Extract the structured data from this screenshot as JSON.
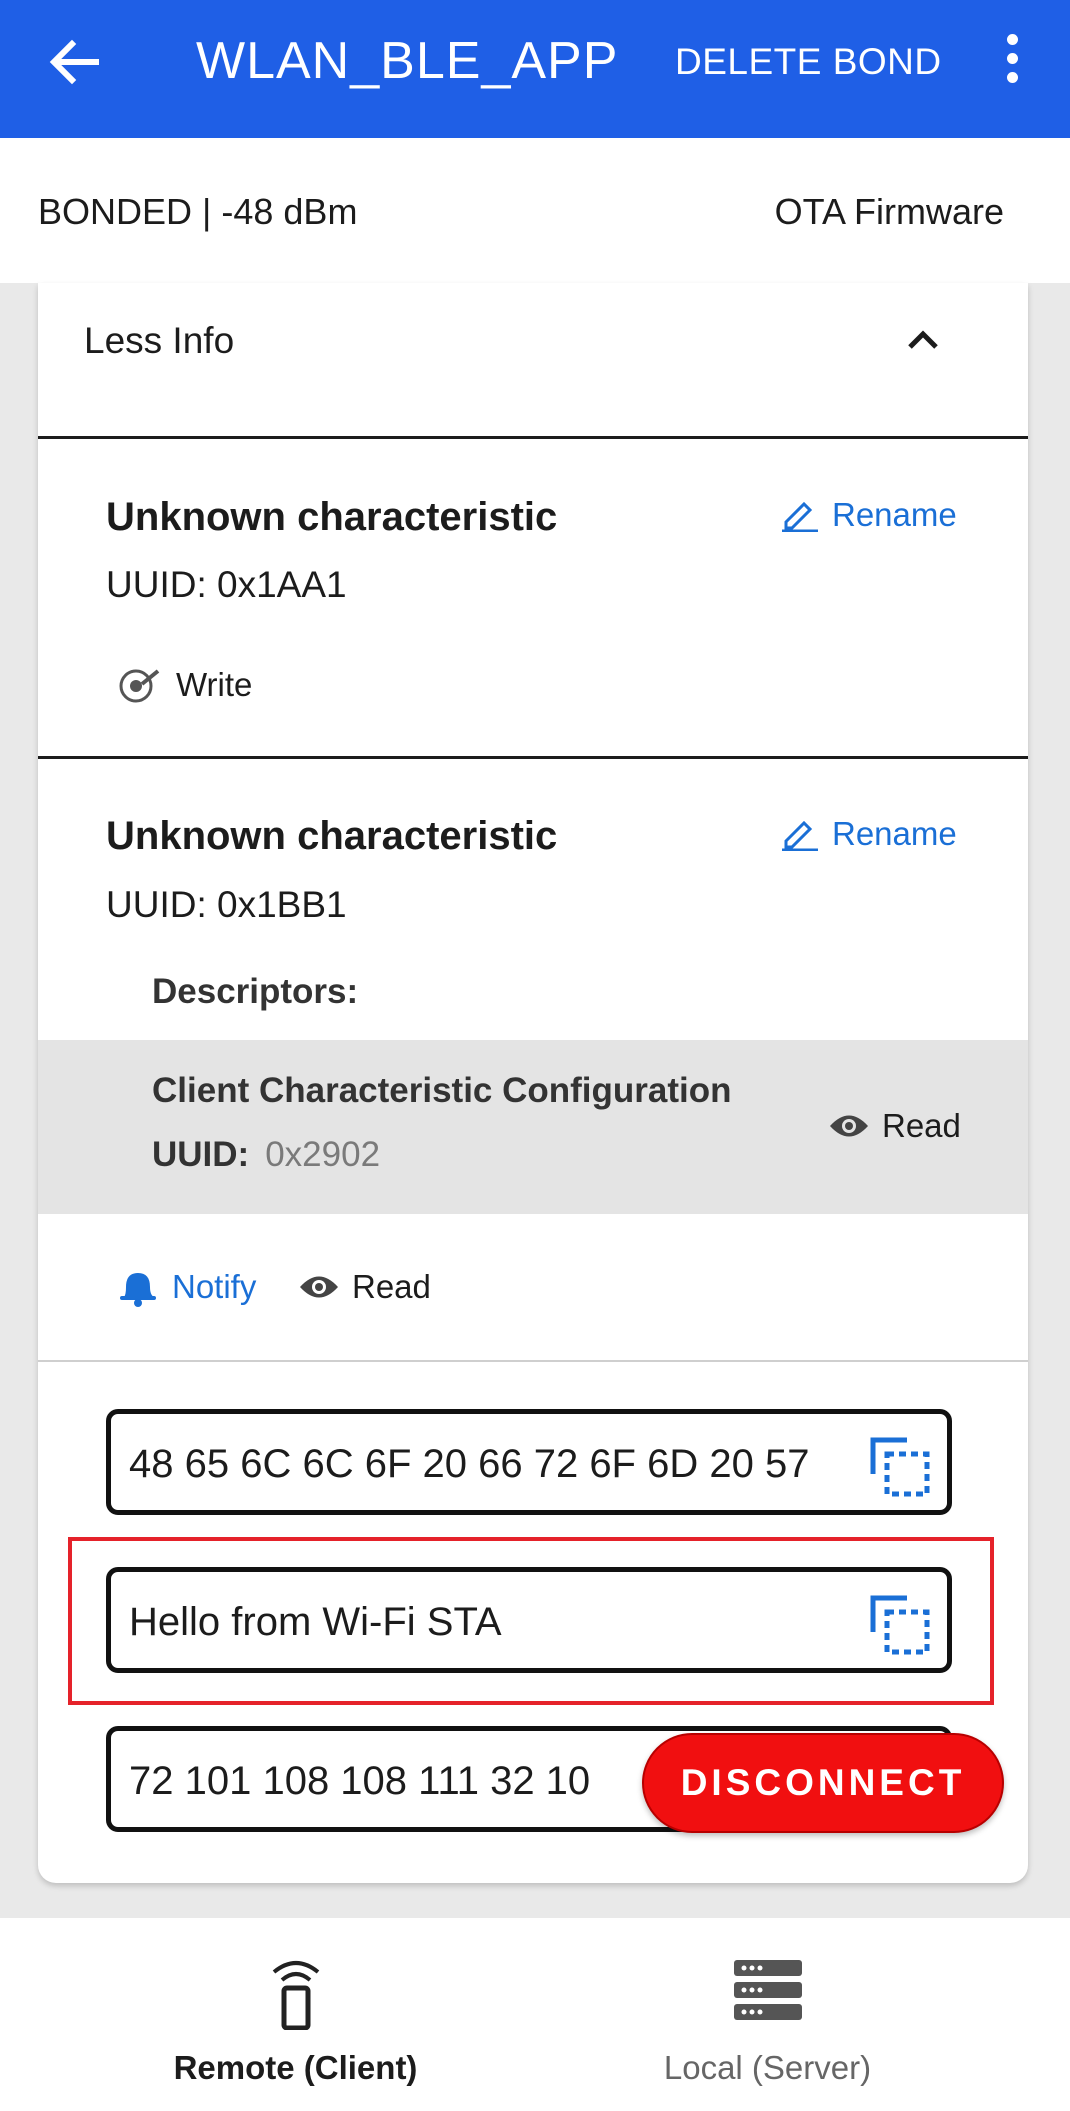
{
  "appbar": {
    "title": "WLAN_BLE_APP",
    "delete_bond": "DELETE BOND"
  },
  "status": {
    "connection": "BONDED | -48 dBm",
    "ota": "OTA Firmware"
  },
  "card": {
    "less_info": "Less Info",
    "characteristics": [
      {
        "title": "Unknown characteristic",
        "uuid": "UUID:  0x1AA1",
        "rename": "Rename",
        "props": [
          "Write"
        ]
      },
      {
        "title": "Unknown characteristic",
        "uuid": "UUID:  0x1BB1",
        "rename": "Rename",
        "descriptors_label": "Descriptors:",
        "descriptor": {
          "name": "Client Characteristic Configuration",
          "uuid_label": "UUID:",
          "uuid_value": "0x2902",
          "prop": "Read"
        },
        "props": [
          "Notify",
          "Read"
        ]
      }
    ],
    "values": {
      "hex": "48 65 6C 6C 6F 20 66 72 6F 6D 20 57",
      "ascii": "Hello from Wi-Fi STA",
      "decimal": "72 101 108 108 111 32 10"
    }
  },
  "disconnect_label": "DISCONNECT",
  "bottom_nav": {
    "remote": "Remote (Client)",
    "local": "Local (Server)"
  },
  "colors": {
    "primary": "#1f5fe6",
    "link": "#1a6fd6",
    "danger": "#f10f10",
    "highlight": "#e5222a"
  }
}
